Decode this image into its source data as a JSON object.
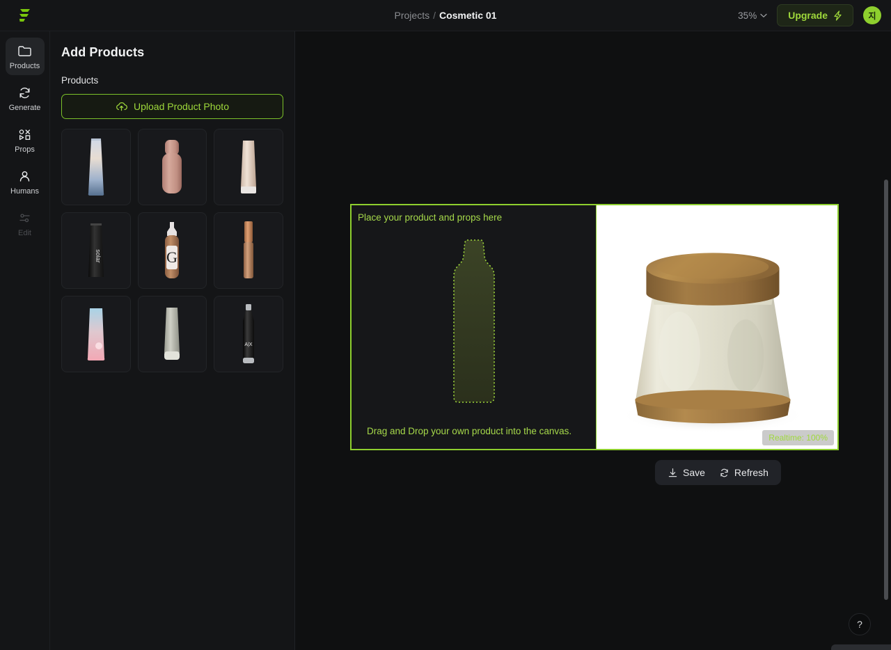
{
  "topbar": {
    "logo_icon": "flair-logo-icon",
    "breadcrumb": {
      "root": "Projects",
      "separator": "/",
      "current": "Cosmetic 01"
    },
    "zoom": {
      "value": "35%",
      "chevron_icon": "chevron-down-icon"
    },
    "upgrade": {
      "label": "Upgrade",
      "icon": "lightning-bolt-icon"
    },
    "avatar": {
      "initial": "지"
    }
  },
  "sidebar": {
    "items": [
      {
        "label": "Products",
        "icon": "folder-icon",
        "active": true,
        "disabled": false
      },
      {
        "label": "Generate",
        "icon": "refresh-icon",
        "active": false,
        "disabled": false
      },
      {
        "label": "Props",
        "icon": "shapes-icon",
        "active": false,
        "disabled": false
      },
      {
        "label": "Humans",
        "icon": "person-icon",
        "active": false,
        "disabled": false
      },
      {
        "label": "Edit",
        "icon": "sliders-icon",
        "active": false,
        "disabled": true
      }
    ]
  },
  "panel": {
    "title": "Add Products",
    "section_label": "Products",
    "upload": {
      "label": "Upload Product Photo",
      "icon": "cloud-upload-icon"
    },
    "products": [
      {
        "name": "blue-gradient-tube"
      },
      {
        "name": "rose-pink-bottle"
      },
      {
        "name": "beige-cream-tube"
      },
      {
        "name": "black-solar-tube"
      },
      {
        "name": "glossier-foundation-dropper"
      },
      {
        "name": "copper-concealer-wand"
      },
      {
        "name": "pink-blue-sunset-tube"
      },
      {
        "name": "sage-grey-tube"
      },
      {
        "name": "black-ax-water-bottle"
      }
    ]
  },
  "canvas": {
    "dropzone": {
      "headline": "Place your product and props here",
      "hint": "Drag and Drop your own product into the canvas.",
      "placeholder_icon": "bottle-silhouette-icon"
    },
    "preview": {
      "image_name": "cream-jar-with-wooden-lid",
      "badge": "Realtime: 100%"
    },
    "actions": [
      {
        "label": "Save",
        "icon": "download-icon"
      },
      {
        "label": "Refresh",
        "icon": "refresh-icon"
      }
    ]
  },
  "help": {
    "label": "?"
  },
  "colors": {
    "accent_green": "#8ecf2e",
    "accent_green_text": "#9fd93b",
    "panel_bg": "#141517",
    "stage_bg": "#0f1011"
  }
}
